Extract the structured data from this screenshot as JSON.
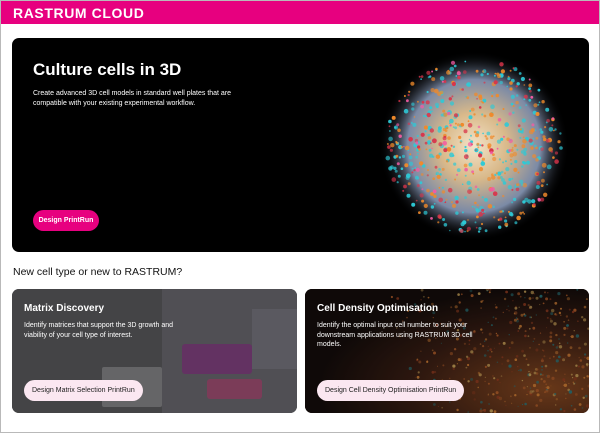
{
  "header": {
    "brand": "RASTRUM CLOUD",
    "brand_color": "#e7007f"
  },
  "hero": {
    "title": "Culture cells in 3D",
    "description": "Create advanced 3D cell models in standard well plates that are compatible with your existing experimental workflow.",
    "button_label": "Design PrintRun"
  },
  "section": {
    "heading": "New cell type or new to RASTRUM?"
  },
  "cards": [
    {
      "title": "Matrix Discovery",
      "description": "Identify matrices that support the 3D growth and viability of your cell type of interest.",
      "button_label": "Design Matrix Selection PrintRun"
    },
    {
      "title": "Cell Density Optimisation",
      "description": "Identify the optimal input cell number to suit your downstream applications using RASTRUM 3D cell models.",
      "button_label": "Design Cell Density Optimisation PrintRun"
    }
  ]
}
